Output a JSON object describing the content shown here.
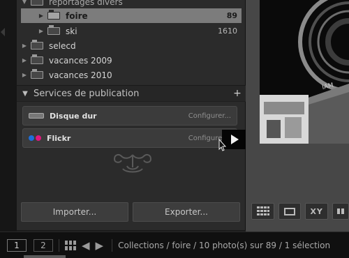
{
  "folders": [
    {
      "label": "reportages divers",
      "count": "",
      "level": 0,
      "expanded": true,
      "state": "dim"
    },
    {
      "label": "foire",
      "count": "89",
      "level": 1,
      "expanded": false,
      "state": "selected"
    },
    {
      "label": "ski",
      "count": "1610",
      "level": 1,
      "expanded": false,
      "state": "normal"
    },
    {
      "label": "selecd",
      "count": "",
      "level": 0,
      "expanded": false,
      "state": "normal"
    },
    {
      "label": "vacances 2009",
      "count": "",
      "level": 0,
      "expanded": false,
      "state": "normal"
    },
    {
      "label": "vacances 2010",
      "count": "",
      "level": 0,
      "expanded": false,
      "state": "normal"
    }
  ],
  "publish": {
    "title": "Services de publication",
    "add_icon": "plus-icon",
    "services": [
      {
        "name": "Disque dur",
        "configure": "Configurer...",
        "icon": "hard-drive-icon"
      },
      {
        "name": "Flickr",
        "configure": "Configurer...",
        "icon": "flickr-icon",
        "colors": [
          "#1e6fd9",
          "#e0187e"
        ]
      }
    ]
  },
  "buttons": {
    "import": "Importer...",
    "export": "Exporter..."
  },
  "view_tools": {
    "grid_icon": "grid-view-icon",
    "loupe_icon": "loupe-view-icon",
    "compare": "XY",
    "survey_icon": "survey-view-icon"
  },
  "filmstrip": {
    "screen1": "1",
    "screen2": "2",
    "path": "Collections / foire / 10 photo(s) sur 89 / 1 sélection"
  },
  "colors": {
    "panel": "#2b2b2b",
    "selected_row": "#7c7c7c",
    "preview_bg": "#474747"
  }
}
